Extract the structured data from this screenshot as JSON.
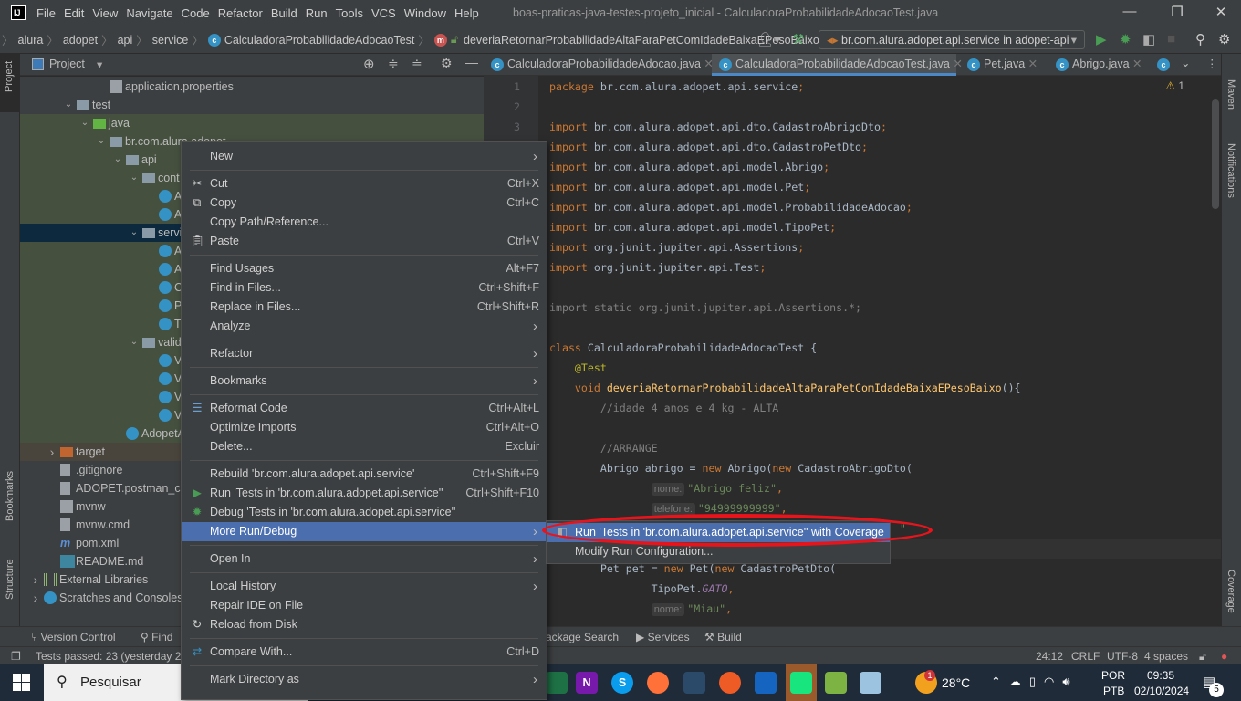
{
  "window": {
    "title": "boas-praticas-java-testes-projeto_inicial - CalculadoraProbabilidadeAdocaoTest.java",
    "menu": [
      "File",
      "Edit",
      "View",
      "Navigate",
      "Code",
      "Refactor",
      "Build",
      "Run",
      "Tools",
      "VCS",
      "Window",
      "Help"
    ],
    "controls": {
      "minimize": "—",
      "maximize": "❐",
      "close": "✕"
    }
  },
  "breadcrumb": [
    "alura",
    "adopet",
    "api",
    "service",
    "CalculadoraProbabilidadeAdocaoTest",
    "deveriaRetornarProbabilidadeAltaParaPetComIdadeBaixaEPesoBaixo"
  ],
  "run_config": "br.com.alura.adopet.api.service in adopet-api",
  "project_panel": {
    "title": "Project",
    "tree": [
      {
        "label": "application.properties",
        "depth": 5,
        "icon": "properties-icon"
      },
      {
        "label": "test",
        "depth": 3,
        "icon": "folder-icon",
        "expanded": true
      },
      {
        "label": "java",
        "depth": 4,
        "icon": "test-folder-icon",
        "expanded": true
      },
      {
        "label": "br.com.alura.adopet",
        "depth": 5,
        "icon": "package-icon",
        "expanded": true
      },
      {
        "label": "api",
        "depth": 6,
        "icon": "package-icon",
        "expanded": true
      },
      {
        "label": "cont",
        "depth": 7,
        "icon": "package-icon",
        "expanded": true
      },
      {
        "label": "A",
        "depth": 8,
        "icon": "test-class-icon"
      },
      {
        "label": "A",
        "depth": 8,
        "icon": "test-class-icon"
      },
      {
        "label": "servi",
        "depth": 7,
        "icon": "package-icon",
        "expanded": true,
        "selected": true
      },
      {
        "label": "A",
        "depth": 8,
        "icon": "test-class-icon"
      },
      {
        "label": "A",
        "depth": 8,
        "icon": "test-class-icon"
      },
      {
        "label": "C",
        "depth": 8,
        "icon": "test-class-icon"
      },
      {
        "label": "P",
        "depth": 8,
        "icon": "test-class-icon"
      },
      {
        "label": "T",
        "depth": 8,
        "icon": "test-class-icon"
      },
      {
        "label": "valid",
        "depth": 7,
        "icon": "package-icon",
        "expanded": true
      },
      {
        "label": "V",
        "depth": 8,
        "icon": "test-class-icon"
      },
      {
        "label": "V",
        "depth": 8,
        "icon": "test-class-icon"
      },
      {
        "label": "V",
        "depth": 8,
        "icon": "test-class-icon"
      },
      {
        "label": "V",
        "depth": 8,
        "icon": "test-class-icon"
      },
      {
        "label": "AdopetA",
        "depth": 6,
        "icon": "test-class-icon"
      },
      {
        "label": "target",
        "depth": 2,
        "icon": "excluded-folder-icon",
        "expanded": false
      },
      {
        "label": ".gitignore",
        "depth": 2,
        "icon": "file-icon"
      },
      {
        "label": "ADOPET.postman_col",
        "depth": 2,
        "icon": "file-icon"
      },
      {
        "label": "mvnw",
        "depth": 2,
        "icon": "shell-icon"
      },
      {
        "label": "mvnw.cmd",
        "depth": 2,
        "icon": "file-icon"
      },
      {
        "label": "pom.xml",
        "depth": 2,
        "icon": "maven-icon"
      },
      {
        "label": "README.md",
        "depth": 2,
        "icon": "markdown-icon"
      },
      {
        "label": "External Libraries",
        "depth": 1,
        "icon": "library-icon",
        "expanded": false
      },
      {
        "label": "Scratches and Consoles",
        "depth": 1,
        "icon": "scratch-icon",
        "expanded": false
      }
    ]
  },
  "side_tools": {
    "left": [
      "Project",
      "Bookmarks",
      "Structure"
    ],
    "right": [
      "Maven",
      "Notifications",
      "Coverage"
    ]
  },
  "tabs": [
    {
      "label": "CalculadoraProbabilidadeAdocao.java",
      "active": false
    },
    {
      "label": "CalculadoraProbabilidadeAdocaoTest.java",
      "active": true
    },
    {
      "label": "Pet.java",
      "active": false
    },
    {
      "label": "Abrigo.java",
      "active": false
    }
  ],
  "editor": {
    "warnings": "1",
    "line_numbers": [
      "1",
      "2",
      "3"
    ],
    "lines": [
      [
        [
          "package ",
          "kw"
        ],
        [
          "br.com.alura.adopet.api.service",
          ""
        ],
        [
          ";",
          "kw"
        ]
      ],
      [],
      [
        [
          "import ",
          "kw"
        ],
        [
          "br.com.alura.adopet.api.dto.CadastroAbrigoDto",
          ""
        ],
        [
          ";",
          "kw"
        ]
      ],
      [
        [
          "import ",
          "kw"
        ],
        [
          "br.com.alura.adopet.api.dto.CadastroPetDto",
          ""
        ],
        [
          ";",
          "kw"
        ]
      ],
      [
        [
          "import ",
          "kw"
        ],
        [
          "br.com.alura.adopet.api.model.Abrigo",
          ""
        ],
        [
          ";",
          "kw"
        ]
      ],
      [
        [
          "import ",
          "kw"
        ],
        [
          "br.com.alura.adopet.api.model.Pet",
          ""
        ],
        [
          ";",
          "kw"
        ]
      ],
      [
        [
          "import ",
          "kw"
        ],
        [
          "br.com.alura.adopet.api.model.ProbabilidadeAdocao",
          ""
        ],
        [
          ";",
          "kw"
        ]
      ],
      [
        [
          "import ",
          "kw"
        ],
        [
          "br.com.alura.adopet.api.model.TipoPet",
          ""
        ],
        [
          ";",
          "kw"
        ]
      ],
      [
        [
          "import ",
          "kw"
        ],
        [
          "org.junit.jupiter.api.Assertions",
          ""
        ],
        [
          ";",
          "kw"
        ]
      ],
      [
        [
          "import ",
          "kw"
        ],
        [
          "org.junit.jupiter.api.Test",
          ""
        ],
        [
          ";",
          "kw"
        ]
      ],
      [],
      [
        [
          "import static org.junit.jupiter.api.Assertions.*;",
          "cm"
        ]
      ],
      [],
      [
        [
          "class ",
          "kw"
        ],
        [
          "CalculadoraProbabilidadeAdocaoTest {",
          ""
        ]
      ],
      [
        [
          "    @Test",
          "an"
        ]
      ],
      [
        [
          "    void ",
          "kw"
        ],
        [
          "deveriaRetornarProbabilidadeAltaParaPetComIdadeBaixaEPesoBaixo",
          "md"
        ],
        [
          "(){",
          ""
        ]
      ],
      [
        [
          "        //idade 4 anos e 4 kg - ALTA",
          "cm"
        ]
      ],
      [],
      [
        [
          "        //ARRANGE",
          "cm"
        ]
      ],
      [
        [
          "        Abrigo abrigo = ",
          ""
        ],
        [
          "new ",
          "kw"
        ],
        [
          "Abrigo(",
          ""
        ],
        [
          "new ",
          "kw"
        ],
        [
          "CadastroAbrigoDto(",
          ""
        ]
      ],
      [
        [
          "                ",
          ""
        ],
        [
          "nome:",
          "hint"
        ],
        [
          "\"Abrigo feliz\"",
          "st"
        ],
        [
          ",",
          "kw"
        ]
      ],
      [
        [
          "                ",
          ""
        ],
        [
          "telefone:",
          "hint"
        ],
        [
          "\"94999999999\"",
          "st"
        ],
        [
          ",",
          "kw"
        ]
      ],
      [
        [
          "                                                       \"",
          "st"
        ]
      ],
      [],
      [
        [
          "        Pet pet = ",
          ""
        ],
        [
          "new ",
          "kw"
        ],
        [
          "Pet(",
          ""
        ],
        [
          "new ",
          "kw"
        ],
        [
          "CadastroPetDto(",
          ""
        ]
      ],
      [
        [
          "                TipoPet.",
          ""
        ],
        [
          "GATO",
          "sf"
        ],
        [
          ",",
          "kw"
        ]
      ],
      [
        [
          "                ",
          ""
        ],
        [
          "nome:",
          "hint"
        ],
        [
          "\"Miau\"",
          "st"
        ],
        [
          ",",
          "kw"
        ]
      ]
    ]
  },
  "context_menu": {
    "items": [
      {
        "label": "New",
        "submenu": true
      },
      {
        "sep": true
      },
      {
        "label": "Cut",
        "shortcut": "Ctrl+X",
        "icon": "scissors-icon"
      },
      {
        "label": "Copy",
        "shortcut": "Ctrl+C",
        "icon": "copy-icon"
      },
      {
        "label": "Copy Path/Reference..."
      },
      {
        "label": "Paste",
        "shortcut": "Ctrl+V",
        "icon": "clipboard-icon"
      },
      {
        "sep": true
      },
      {
        "label": "Find Usages",
        "shortcut": "Alt+F7"
      },
      {
        "label": "Find in Files...",
        "shortcut": "Ctrl+Shift+F"
      },
      {
        "label": "Replace in Files...",
        "shortcut": "Ctrl+Shift+R"
      },
      {
        "label": "Analyze",
        "submenu": true
      },
      {
        "sep": true
      },
      {
        "label": "Refactor",
        "submenu": true
      },
      {
        "sep": true
      },
      {
        "label": "Bookmarks",
        "submenu": true
      },
      {
        "sep": true
      },
      {
        "label": "Reformat Code",
        "shortcut": "Ctrl+Alt+L",
        "icon": "reformat-icon"
      },
      {
        "label": "Optimize Imports",
        "shortcut": "Ctrl+Alt+O"
      },
      {
        "label": "Delete...",
        "shortcut": "Excluir"
      },
      {
        "sep": true
      },
      {
        "label": "Rebuild 'br.com.alura.adopet.api.service'",
        "shortcut": "Ctrl+Shift+F9"
      },
      {
        "label": "Run 'Tests in 'br.com.alura.adopet.api.service''",
        "shortcut": "Ctrl+Shift+F10",
        "icon": "run-icon"
      },
      {
        "label": "Debug 'Tests in 'br.com.alura.adopet.api.service''",
        "icon": "debug-icon"
      },
      {
        "label": "More Run/Debug",
        "submenu": true,
        "selected": true
      },
      {
        "sep": true
      },
      {
        "label": "Open In",
        "submenu": true
      },
      {
        "sep": true
      },
      {
        "label": "Local History",
        "submenu": true
      },
      {
        "label": "Repair IDE on File"
      },
      {
        "label": "Reload from Disk",
        "icon": "reload-icon"
      },
      {
        "sep": true
      },
      {
        "label": "Compare With...",
        "shortcut": "Ctrl+D",
        "icon": "compare-icon"
      },
      {
        "sep": true
      },
      {
        "label": "Mark Directory as",
        "submenu": true
      }
    ]
  },
  "submenu": {
    "items": [
      {
        "label": "Run 'Tests in 'br.com.alura.adopet.api.service'' with Coverage",
        "selected": true,
        "icon": "coverage-icon"
      },
      {
        "label": "Modify Run Configuration..."
      }
    ]
  },
  "bottom_tools": [
    "Version Control",
    "Find",
    "ackage Search",
    "Services",
    "Build"
  ],
  "status": {
    "message": "Tests passed: 23 (yesterday 22:",
    "position": "24:12",
    "line_sep": "CRLF",
    "encoding": "UTF-8",
    "indent": "4 spaces"
  },
  "taskbar": {
    "search_placeholder": "Pesquisar",
    "weather": "28°C",
    "weather_badge": "1",
    "lang": "POR",
    "layout": "PTB",
    "time": "09:35",
    "date": "02/10/2024",
    "notifications": "5"
  },
  "colors": {
    "accent": "#4b6eaf",
    "highlight_ellipse": "#e8141c",
    "ide_bg": "#2b2b2b",
    "panel_bg": "#3c3f41"
  }
}
